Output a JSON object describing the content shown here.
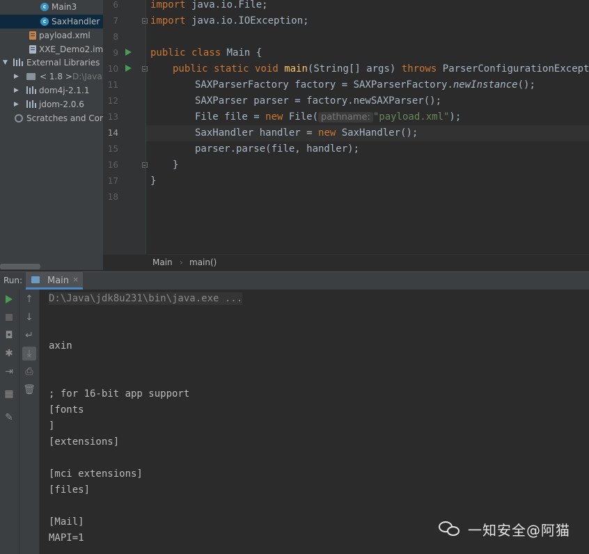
{
  "sidebar": {
    "items": [
      {
        "label": "Main3",
        "icon": "class-icon"
      },
      {
        "label": "SaxHandler",
        "icon": "class-icon",
        "selected": true
      },
      {
        "label": "payload.xml",
        "icon": "xml-file-icon"
      },
      {
        "label": "XXE_Demo2.iml",
        "icon": "iml-file-icon"
      },
      {
        "label": "External Libraries",
        "icon": "library-icon"
      },
      {
        "label": "< 1.8 >",
        "suffix": "D:\\Java",
        "icon": "jdk-folder-icon"
      },
      {
        "label": "dom4j-2.1.1",
        "icon": "library-icon"
      },
      {
        "label": "jdom-2.0.6",
        "icon": "library-icon"
      },
      {
        "label": "Scratches and Con",
        "icon": "scratches-icon"
      }
    ]
  },
  "editor": {
    "line_numbers": [
      "6",
      "7",
      "8",
      "9",
      "10",
      "11",
      "12",
      "13",
      "14",
      "15",
      "16",
      "17",
      "18"
    ],
    "current_line": "14",
    "lines": {
      "l6": {
        "kw": "import",
        "rest": " java.io.File;"
      },
      "l7": {
        "kw": "import",
        "rest": " java.io.IOException;"
      },
      "l9": {
        "kw1": "public",
        "kw2": "class",
        "rest": " Main {"
      },
      "l10": {
        "kw1": "public",
        "kw2": "static",
        "kw3": "void",
        "fn": "main",
        "mid": "(String[] args) ",
        "kw4": "throws",
        "rest": " ParserConfigurationException,"
      },
      "l11": {
        "a": "SAXParserFactory factory = SAXParserFactory.",
        "it": "newInstance",
        "b": "();"
      },
      "l12": {
        "a": "SAXParser parser = factory.newSAXParser();"
      },
      "l13": {
        "a": "File file = ",
        "kw": "new",
        "b": " File(",
        "hint": "pathname:",
        "str": "\"payload.xml\"",
        "c": ");"
      },
      "l14": {
        "a": "SaxHandler handler = ",
        "kw": "new",
        "b": " SaxHandler();"
      },
      "l15": {
        "a": "parser.parse(file, handler);"
      },
      "l16": {
        "a": "}"
      },
      "l17": {
        "a": "}"
      }
    }
  },
  "breadcrumb": {
    "class": "Main",
    "method": "main()",
    "separator": "›"
  },
  "run": {
    "label": "Run:",
    "tab": "Main",
    "close": "×",
    "console": {
      "command": "D:\\Java\\jdk8u231\\bin\\java.exe ...",
      "lines": [
        "axin",
        "; for 16-bit app support",
        "[fonts",
        "]",
        "[extensions]",
        "[mci extensions]",
        "[files]",
        "[Mail]",
        "MAPI=1"
      ]
    }
  },
  "watermark": {
    "text": "一知安全@阿猫"
  },
  "colors": {
    "keyword": "#cc7832",
    "function": "#ffc66d",
    "string": "#6a8759",
    "run_green": "#499c54"
  }
}
